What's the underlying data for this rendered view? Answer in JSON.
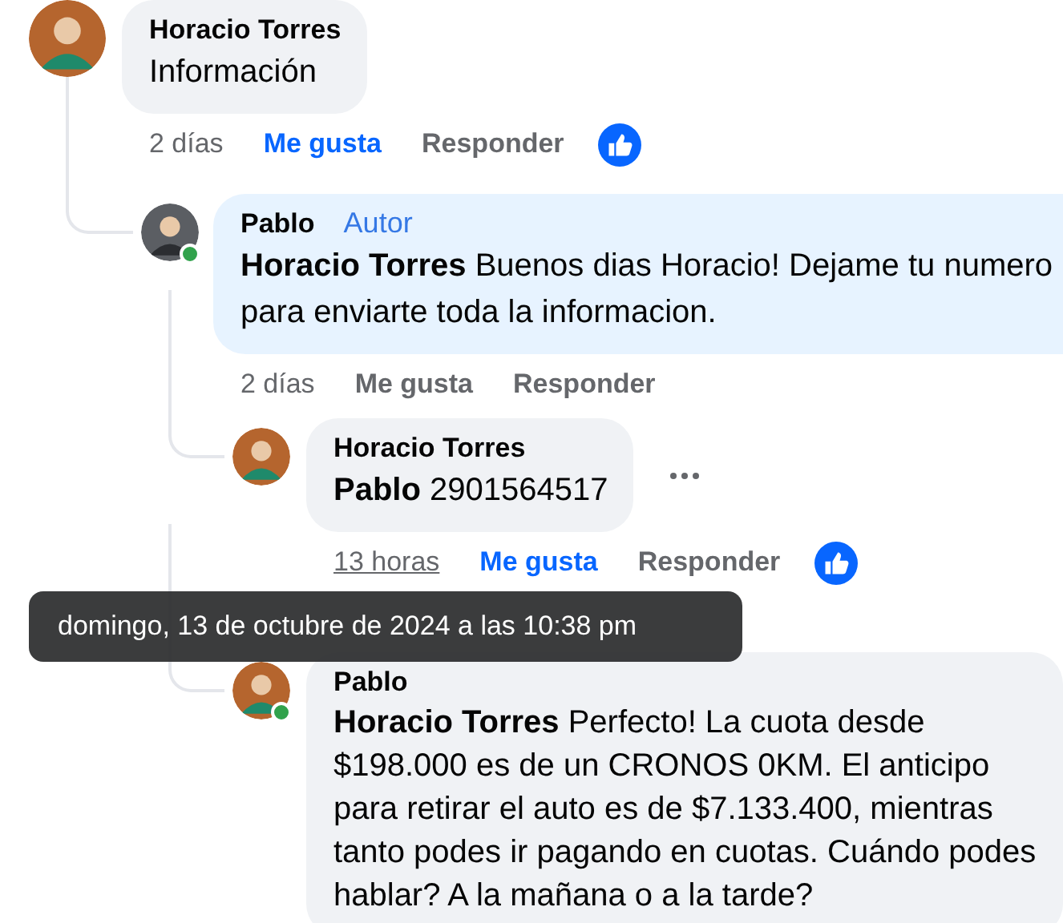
{
  "comments": [
    {
      "author": "Horacio Torres",
      "text": "Información",
      "time": "2 días",
      "time_hovered": false,
      "like_label": "Me gusta",
      "liked": true,
      "reply_label": "Responder",
      "reaction": true,
      "color": "#f0f2f5",
      "children": [
        {
          "author": "Pablo",
          "badge": "Autor",
          "text": "**Horacio Torres** Buenos dias Horacio! Dejame tu numero para enviarte toda la informacion.",
          "time": "2 días",
          "time_hovered": false,
          "like_label": "Me gusta",
          "liked": false,
          "reply_label": "Responder",
          "online": true,
          "color": "#e7f3ff",
          "children": [
            {
              "author": "Horacio Torres",
              "text": "**Pablo** 2901564517",
              "time": "13 horas",
              "time_hovered": true,
              "like_label": "Me gusta",
              "liked": true,
              "reply_label": "Responder",
              "reaction": true,
              "color": "#f0f2f5",
              "show_more": true
            },
            {
              "author": "Pablo",
              "text": "**Horacio Torres** Perfecto! La cuota desde $198.000 es de un CRONOS 0KM. El anticipo para retirar el auto es de $7.133.400, mientras tanto podes ir pagando en cuotas. Cuándo podes hablar? A la mañana o a la tarde?",
              "online": true,
              "color": "#f0f2f5"
            }
          ]
        }
      ]
    }
  ],
  "tooltip": {
    "text": "domingo, 13 de octubre de 2024 a las 10:38 pm"
  }
}
